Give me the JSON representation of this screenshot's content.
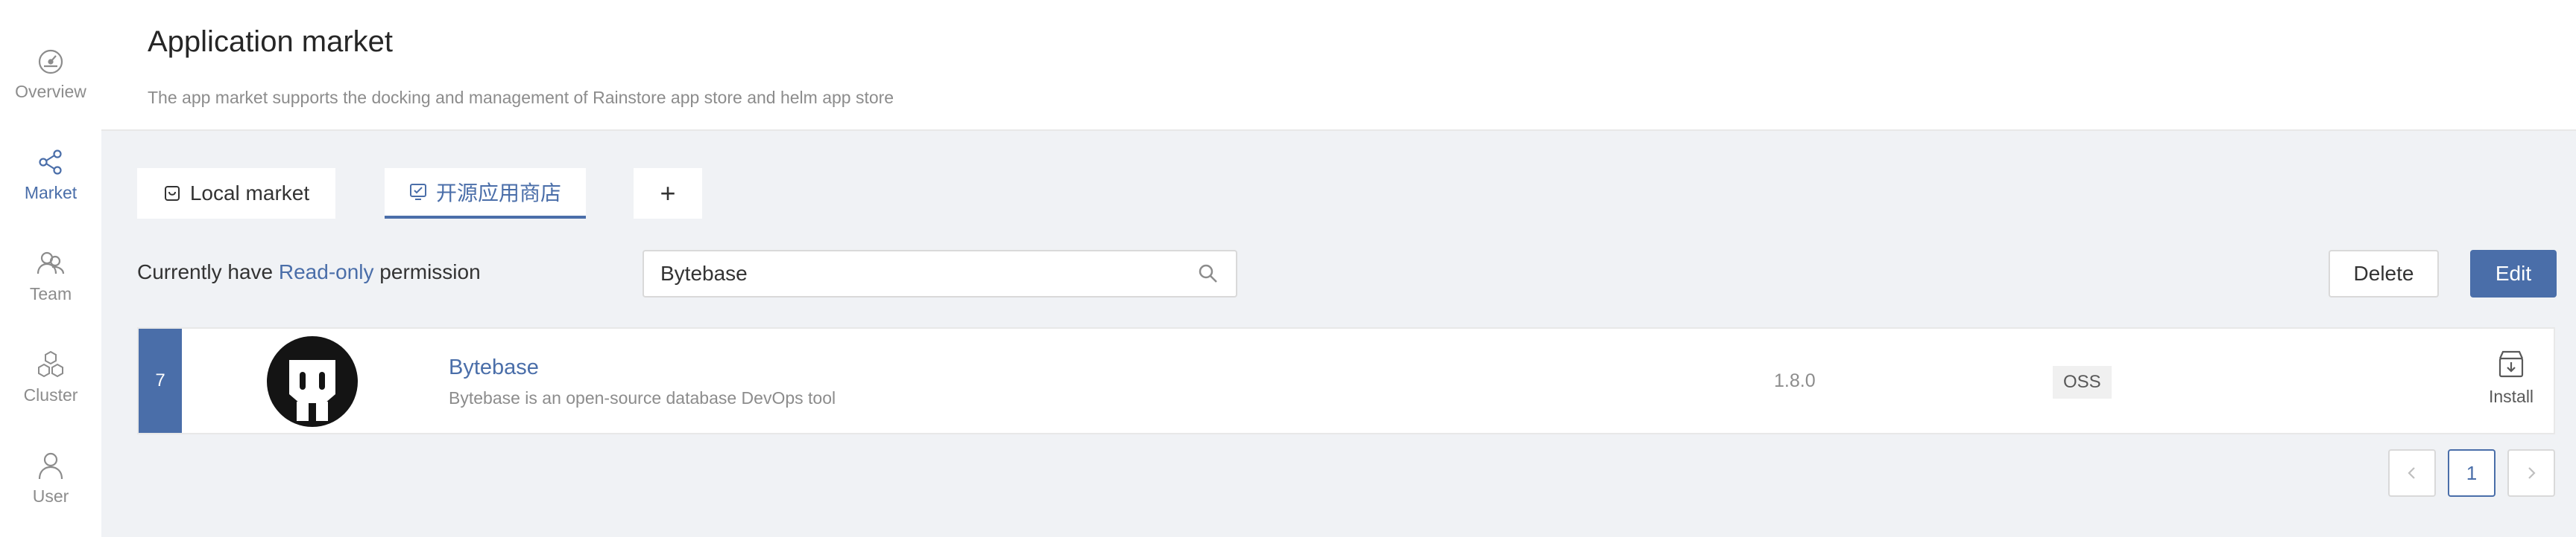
{
  "sidebar": {
    "items": [
      {
        "label": "Overview",
        "icon": "dashboard-icon",
        "active": false
      },
      {
        "label": "Market",
        "icon": "share-icon",
        "active": true
      },
      {
        "label": "Team",
        "icon": "team-icon",
        "active": false
      },
      {
        "label": "Cluster",
        "icon": "cluster-icon",
        "active": false
      },
      {
        "label": "User",
        "icon": "user-icon",
        "active": false
      }
    ]
  },
  "header": {
    "title": "Application market",
    "description": "The app market supports the docking and management of Rainstore app store and helm app store"
  },
  "tabs": [
    {
      "label": "Local market",
      "icon": "store-icon",
      "active": false
    },
    {
      "label": "开源应用商店",
      "icon": "cloud-store-icon",
      "active": true
    },
    {
      "label": "+",
      "icon": "plus-icon",
      "active": false
    }
  ],
  "toolbar": {
    "permission_prefix": "Currently have ",
    "permission_value": "Read-only",
    "permission_suffix": " permission",
    "search_value": "Bytebase",
    "delete_label": "Delete",
    "edit_label": "Edit"
  },
  "apps": [
    {
      "index": "7",
      "name": "Bytebase",
      "description": "Bytebase is an open-source database DevOps tool",
      "version": "1.8.0",
      "tag": "OSS",
      "action_label": "Install"
    }
  ],
  "pagination": {
    "current": "1"
  },
  "colors": {
    "accent": "#4a6ea9",
    "background": "#f0f2f5"
  }
}
